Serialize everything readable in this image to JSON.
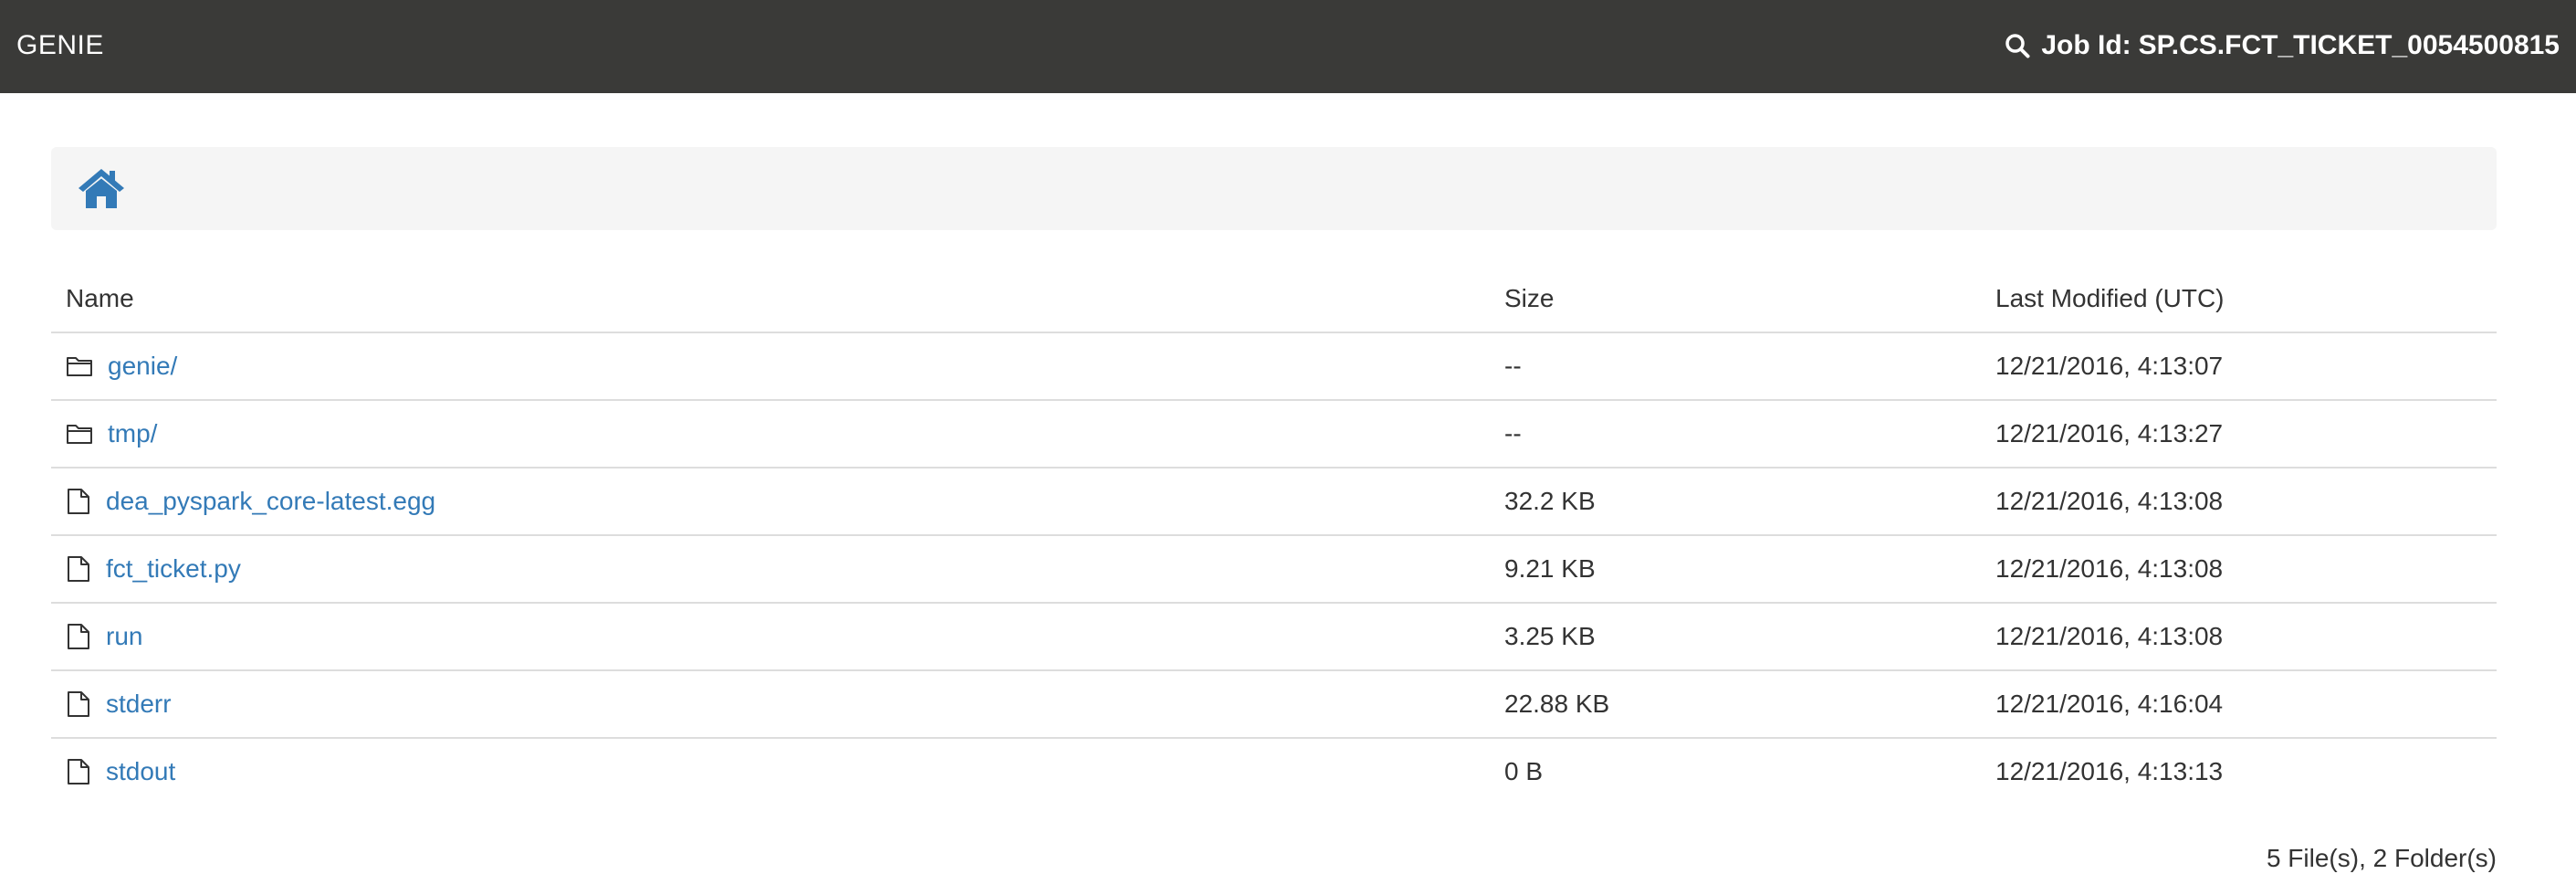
{
  "header": {
    "brand": "GENIE",
    "job_id_label": "Job Id:",
    "job_id": "SP.CS.FCT_TICKET_0054500815"
  },
  "breadcrumb": {
    "home_icon": "home-icon"
  },
  "table": {
    "columns": {
      "name": "Name",
      "size": "Size",
      "modified": "Last Modified (UTC)"
    },
    "rows": [
      {
        "type": "folder",
        "icon": "folder-icon",
        "name": "genie/",
        "size": "--",
        "modified": "12/21/2016, 4:13:07"
      },
      {
        "type": "folder",
        "icon": "folder-icon",
        "name": "tmp/",
        "size": "--",
        "modified": "12/21/2016, 4:13:27"
      },
      {
        "type": "file",
        "icon": "file-icon",
        "name": "dea_pyspark_core-latest.egg",
        "size": "32.2 KB",
        "modified": "12/21/2016, 4:13:08"
      },
      {
        "type": "file",
        "icon": "file-icon",
        "name": "fct_ticket.py",
        "size": "9.21 KB",
        "modified": "12/21/2016, 4:13:08"
      },
      {
        "type": "file",
        "icon": "file-icon",
        "name": "run",
        "size": "3.25 KB",
        "modified": "12/21/2016, 4:13:08"
      },
      {
        "type": "file",
        "icon": "file-icon",
        "name": "stderr",
        "size": "22.88 KB",
        "modified": "12/21/2016, 4:16:04"
      },
      {
        "type": "file",
        "icon": "file-icon",
        "name": "stdout",
        "size": "0 B",
        "modified": "12/21/2016, 4:13:13"
      }
    ]
  },
  "summary": "5 File(s), 2 Folder(s)",
  "colors": {
    "topbar": "#3a3a38",
    "link": "#337ab7",
    "breadcrumb_bg": "#f5f5f5"
  }
}
